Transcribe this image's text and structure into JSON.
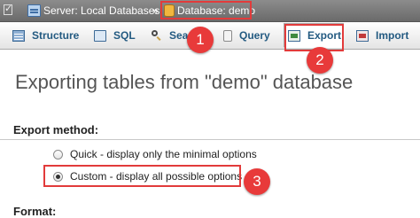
{
  "breadcrumb": {
    "server_label": "Server: Local Databases",
    "separator": "»",
    "database_label": "Database: demo"
  },
  "tabs": [
    {
      "label": "Structure",
      "icon": "structure-icon"
    },
    {
      "label": "SQL",
      "icon": "sql-icon"
    },
    {
      "label": "Sea",
      "icon": "search-icon"
    },
    {
      "label": "Query",
      "icon": "query-icon"
    },
    {
      "label": "Export",
      "icon": "export-icon",
      "active": true
    },
    {
      "label": "Import",
      "icon": "import-icon"
    }
  ],
  "badges": [
    "1",
    "2",
    "3"
  ],
  "main": {
    "title": "Exporting tables from \"demo\" database",
    "export_method_heading": "Export method:",
    "options": [
      {
        "label": "Quick - display only the minimal options",
        "selected": false
      },
      {
        "label": "Custom - display all possible options",
        "selected": true
      }
    ],
    "format_heading": "Format:"
  },
  "colors": {
    "highlight": "#e23b3b",
    "badge": "#e83a3a",
    "tab_text": "#235a81"
  }
}
